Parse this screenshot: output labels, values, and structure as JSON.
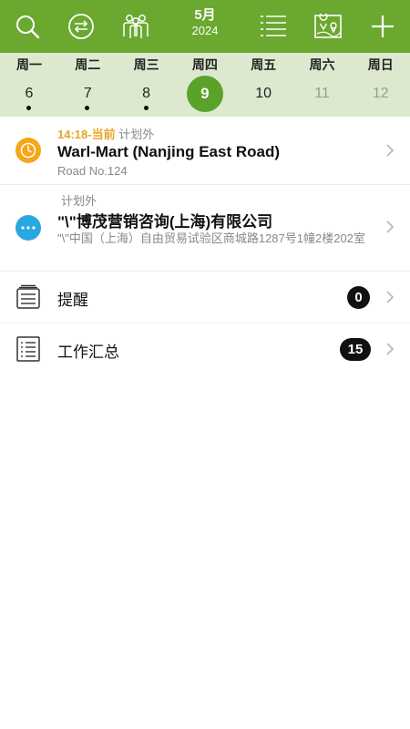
{
  "header": {
    "month": "5月",
    "year": "2024",
    "icons": [
      "search-icon",
      "sync-icon",
      "team-icon",
      "list-icon",
      "map-icon",
      "add-icon"
    ]
  },
  "week": {
    "days": [
      {
        "weekday": "周一",
        "date": "6",
        "has_visit": true,
        "state": "past"
      },
      {
        "weekday": "周二",
        "date": "7",
        "has_visit": true,
        "state": "past"
      },
      {
        "weekday": "周三",
        "date": "8",
        "has_visit": true,
        "state": "past"
      },
      {
        "weekday": "周四",
        "date": "9",
        "has_visit": false,
        "state": "today"
      },
      {
        "weekday": "周五",
        "date": "10",
        "has_visit": false,
        "state": "normal"
      },
      {
        "weekday": "周六",
        "date": "11",
        "has_visit": false,
        "state": "future"
      },
      {
        "weekday": "周日",
        "date": "12",
        "has_visit": false,
        "state": "future"
      }
    ]
  },
  "visits": [
    {
      "time": "14:18-当前",
      "tag": "计划外",
      "title": "Warl-Mart (Nanjing East Road)",
      "address": "Road No.124",
      "icon": "clock-icon",
      "icon_color": "#f5a716"
    },
    {
      "time": "",
      "tag": "计划外",
      "title": "\"\\\"博茂营销咨询(上海)有限公司",
      "address": "\"\\\"中国（上海）自由贸易试验区商城路1287号1幢2楼202室",
      "icon": "more-icon",
      "icon_color": "#29a8e0"
    }
  ],
  "summary": [
    {
      "label": "提醒",
      "count": "0",
      "icon": "reminder-icon"
    },
    {
      "label": "工作汇总",
      "count": "15",
      "icon": "checklist-icon"
    }
  ],
  "colors": {
    "header_bg": "#6aa82f",
    "week_bg": "#dde9cf",
    "today": "#5aa22a",
    "time_accent": "#e8a623"
  }
}
